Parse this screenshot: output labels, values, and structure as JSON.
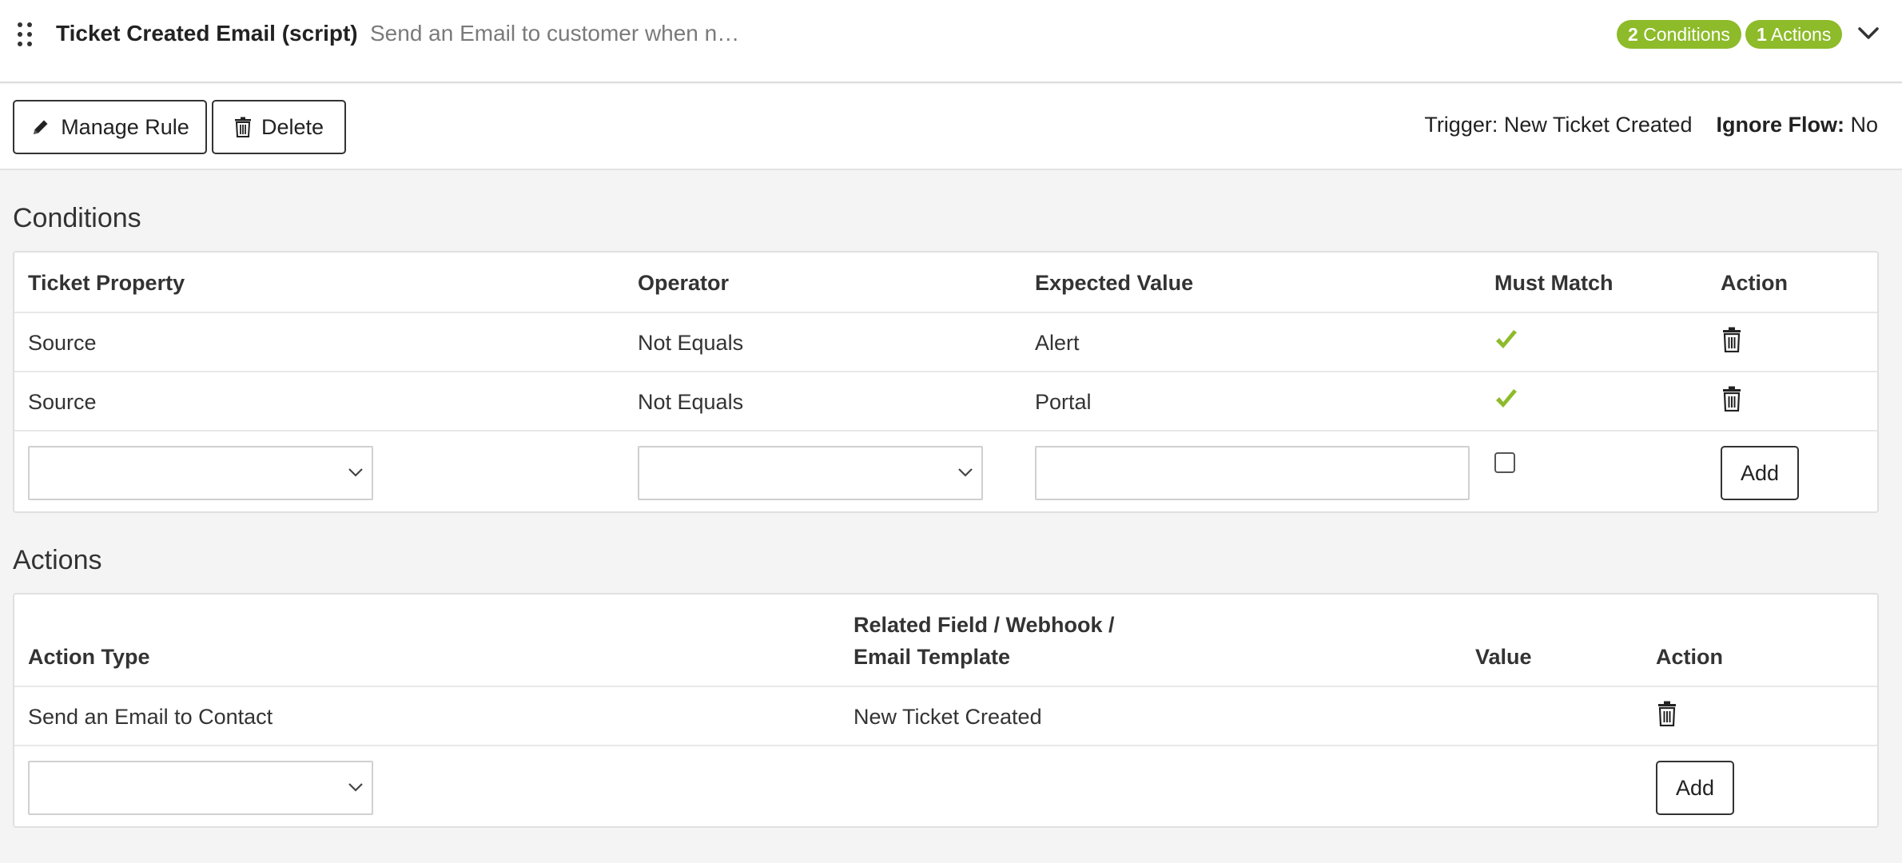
{
  "rule": {
    "title": "Ticket Created Email (script)",
    "description": "Send an Email to customer when n…",
    "conditions_badge": {
      "count": "2",
      "label": "Conditions"
    },
    "actions_badge": {
      "count": "1",
      "label": "Actions"
    }
  },
  "toolbar": {
    "manage_label": "Manage Rule",
    "delete_label": "Delete",
    "trigger_label": "Trigger:",
    "trigger_value": "New Ticket Created",
    "ignore_flow_label": "Ignore Flow:",
    "ignore_flow_value": "No"
  },
  "conditions": {
    "title": "Conditions",
    "headers": [
      "Ticket Property",
      "Operator",
      "Expected Value",
      "Must Match",
      "Action"
    ],
    "rows": [
      {
        "property": "Source",
        "operator": "Not Equals",
        "value": "Alert",
        "must_match": true
      },
      {
        "property": "Source",
        "operator": "Not Equals",
        "value": "Portal",
        "must_match": true
      }
    ],
    "new_row": {
      "property": "",
      "operator": "",
      "value": "",
      "must_match": false,
      "add_label": "Add"
    }
  },
  "actions": {
    "title": "Actions",
    "headers": [
      "Action Type",
      "Related Field / Webhook /",
      "Email Template",
      "Value",
      "Action"
    ],
    "rows": [
      {
        "type": "Send an Email to Contact",
        "related": "New Ticket Created",
        "value": ""
      }
    ],
    "new_row": {
      "type": "",
      "add_label": "Add"
    }
  },
  "colors": {
    "accent": "#8dbb2a",
    "check": "#8dbb2a",
    "border": "#e0e0e0",
    "background": "#f4f4f4"
  },
  "icons": [
    "drag-handle-icon",
    "chevron-down-icon",
    "pencil-icon",
    "trash-icon",
    "check-icon"
  ]
}
